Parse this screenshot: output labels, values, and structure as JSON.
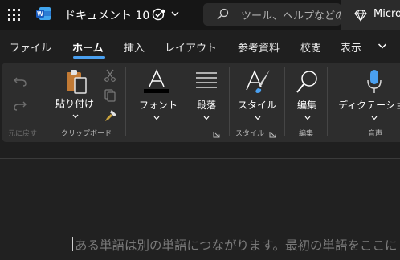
{
  "titlebar": {
    "doc_title": "ドキュメント 10",
    "search_placeholder": "ツール、ヘルプなどの",
    "premium_label": "Micro"
  },
  "tabs": [
    "ファイル",
    "ホーム",
    "挿入",
    "レイアウト",
    "参考資料",
    "校閲",
    "表示"
  ],
  "active_tab": "ホーム",
  "ribbon": {
    "undo": {
      "group_label": "元に戻す"
    },
    "clipboard": {
      "paste_label": "貼り付け",
      "group_label": "クリップボード"
    },
    "font": {
      "label": "フォント"
    },
    "paragraph": {
      "label": "段落"
    },
    "styles": {
      "label": "スタイル",
      "group_label": "スタイル"
    },
    "editing": {
      "label": "編集",
      "group_label": "編集"
    },
    "voice": {
      "label": "ディクテーション",
      "group_label": "音声"
    }
  },
  "document": {
    "placeholder": "ある単語は別の単語につながります。最初の単語をここに"
  },
  "colors": {
    "accent": "#4aa0f0",
    "word_blue": "#2b5fb8",
    "background": "#1f1f1f",
    "ribbon": "#2d2d2d"
  }
}
